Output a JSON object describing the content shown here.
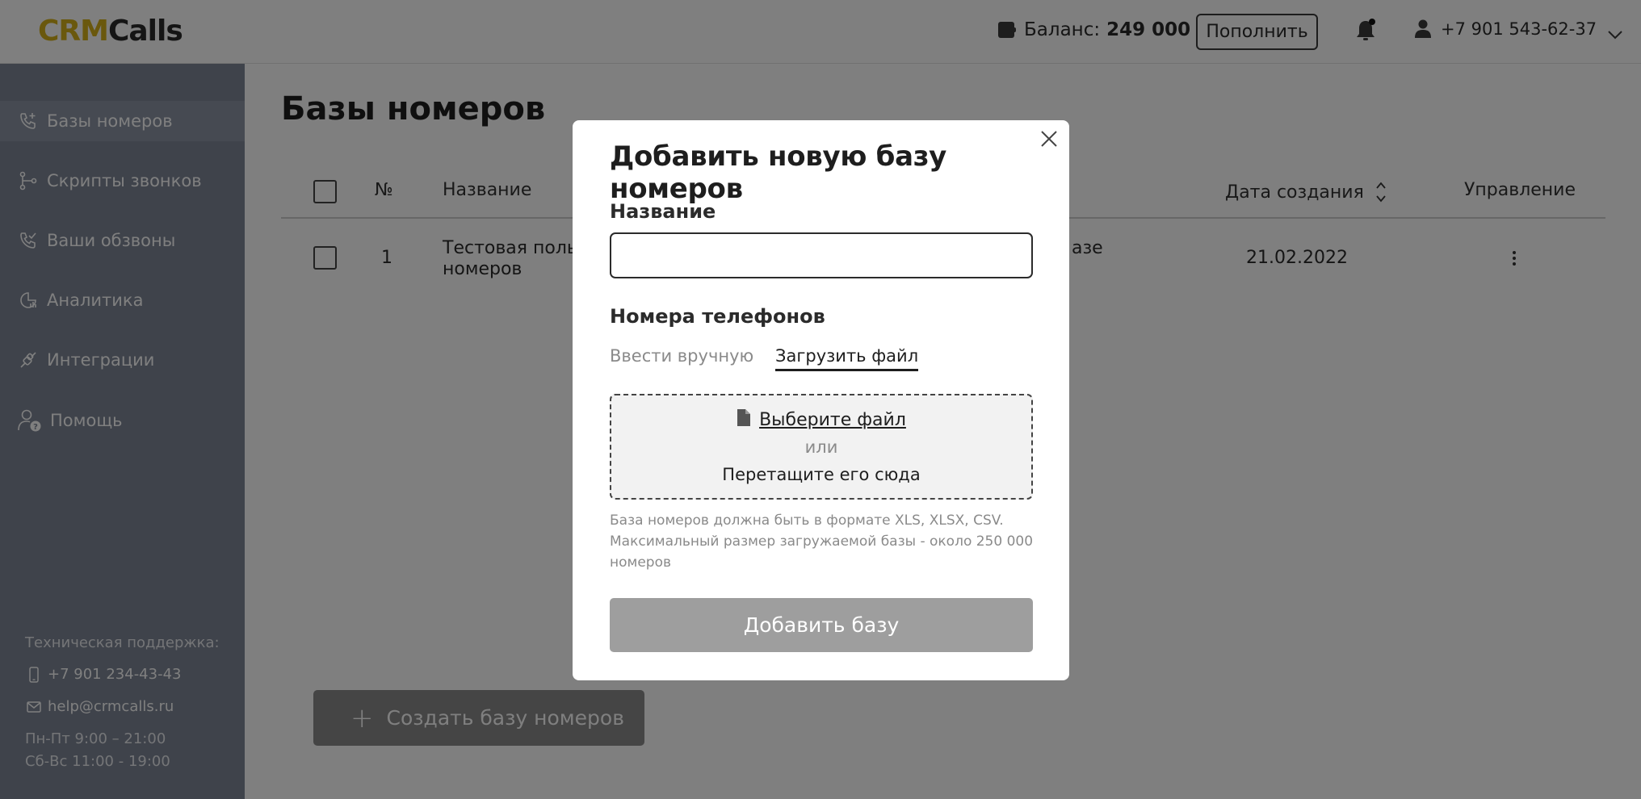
{
  "header": {
    "logo_part1": "CRM",
    "logo_part2": "Calls",
    "balance_label": "Баланс:",
    "balance_value": "249 000 ₽",
    "topup_label": "Пополнить",
    "user_phone": "+7 901 543-62-37",
    "icons": [
      "wallet-icon",
      "bell-icon",
      "user-icon",
      "chevron-down-icon"
    ]
  },
  "sidebar": {
    "items": [
      {
        "label": "Базы номеров",
        "icon": "phone-plus-icon",
        "active": true
      },
      {
        "label": "Скрипты звонков",
        "icon": "script-icon",
        "active": false
      },
      {
        "label": "Ваши обзвоны",
        "icon": "phone-check-icon",
        "active": false
      },
      {
        "label": "Аналитика",
        "icon": "analytics-icon",
        "active": false
      },
      {
        "label": "Интеграции",
        "icon": "integration-icon",
        "active": false
      },
      {
        "label": "Помощь",
        "icon": "help-icon",
        "active": false
      }
    ],
    "support": {
      "title": "Техническая поддержка:",
      "phone": "+7 901 234-43-43",
      "email": "help@crmcalls.ru",
      "hours_weekdays": "Пн-Пт 9:00 – 21:00",
      "hours_weekend": "Сб-Вс 11:00 - 19:00"
    }
  },
  "main": {
    "title": "Базы номеров",
    "table": {
      "columns": {
        "number": "№",
        "name": "Название",
        "date": "Дата создания",
        "actions": "Управление"
      },
      "rows": [
        {
          "number": "1",
          "name_line1": "Тестовая пользо",
          "name_line2": "номеров",
          "desc_fragment": "азе",
          "date": "21.02.2022"
        }
      ]
    },
    "create_button_label": "Создать базу номеров"
  },
  "modal": {
    "title": "Добавить новую базу номеров",
    "name_label": "Название",
    "name_value": "",
    "phones_label": "Номера  телефонов",
    "tab_manual": "Ввести вручную",
    "tab_upload": "Загрузить файл",
    "active_tab": "Загрузить файл",
    "dropzone": {
      "choose_label": "Выберите файл",
      "or_label": "или",
      "drag_label": "Перетащите его сюда"
    },
    "hint": "База номеров должна быть в формате XLS, XLSX, CSV. Максимальный размер загружаемой базы - около 250 000 номеров",
    "submit_label": "Добавить базу"
  }
}
